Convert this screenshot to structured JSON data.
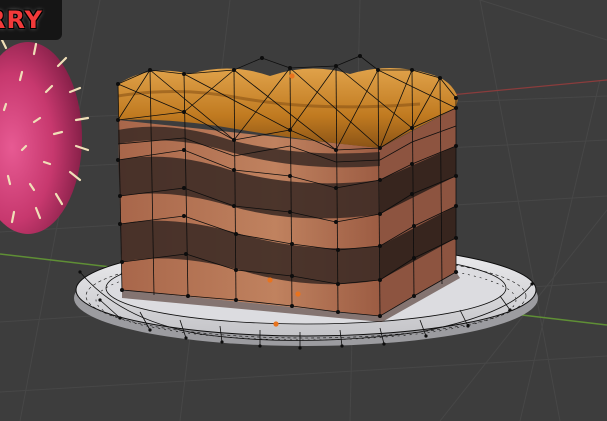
{
  "viewport": {
    "label_text": "RRY",
    "colors": {
      "background": "#3d3d3d",
      "grid_line": "#474747",
      "axis_green": "#5f8f35",
      "axis_red": "#8a3c3c",
      "cake_sponge": "#b87a5a",
      "cake_chocolate": "#3b2a24",
      "frosting_caramel": "#c77f22",
      "plate": "#d8d8da",
      "wire": "#0d0d0d",
      "berry": "#c7386e",
      "seed": "#f0dfb8",
      "selection_origin": "#e8731e"
    }
  }
}
